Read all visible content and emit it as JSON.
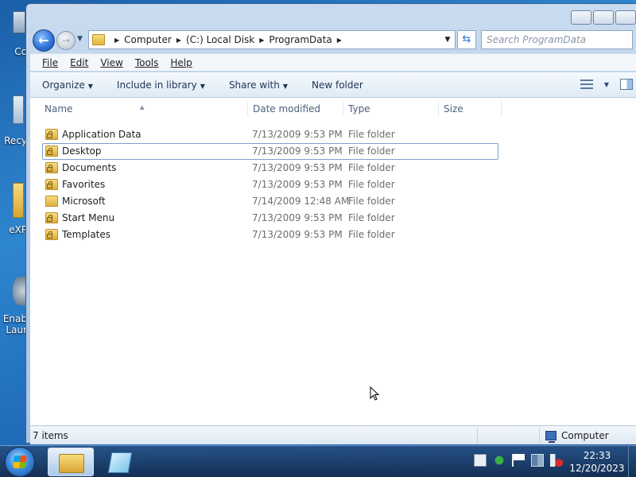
{
  "desktop": {
    "icons": [
      {
        "label": "Co",
        "icon": "computer-icon"
      },
      {
        "label": "Recy",
        "icon": "recycle-bin-icon"
      },
      {
        "label": "eXP",
        "icon": "folder-icon"
      },
      {
        "label": "Enab",
        "label2": "Laur",
        "icon": "launcher-icon"
      }
    ]
  },
  "window": {
    "address": {
      "crumbs": [
        "Computer",
        "(C:) Local Disk",
        "ProgramData"
      ]
    },
    "search": {
      "placeholder": "Search ProgramData"
    },
    "menu": [
      "File",
      "Edit",
      "View",
      "Tools",
      "Help"
    ],
    "toolbar": {
      "organize": "Organize",
      "include_library": "Include in library",
      "share_with": "Share with",
      "new_folder": "New folder"
    },
    "columns": {
      "name": "Name",
      "date": "Date modified",
      "type": "Type",
      "size": "Size"
    },
    "files": [
      {
        "name": "Application Data",
        "date": "7/13/2009 9:53 PM",
        "type": "File folder",
        "locked": true
      },
      {
        "name": "Desktop",
        "date": "7/13/2009 9:53 PM",
        "type": "File folder",
        "locked": true,
        "selected": true
      },
      {
        "name": "Documents",
        "date": "7/13/2009 9:53 PM",
        "type": "File folder",
        "locked": true
      },
      {
        "name": "Favorites",
        "date": "7/13/2009 9:53 PM",
        "type": "File folder",
        "locked": true
      },
      {
        "name": "Microsoft",
        "date": "7/14/2009 12:48 AM",
        "type": "File folder",
        "locked": false
      },
      {
        "name": "Start Menu",
        "date": "7/13/2009 9:53 PM",
        "type": "File folder",
        "locked": true
      },
      {
        "name": "Templates",
        "date": "7/13/2009 9:53 PM",
        "type": "File folder",
        "locked": true
      }
    ],
    "status": {
      "items": "7 items",
      "location": "Computer"
    }
  },
  "taskbar": {
    "time": "22:33",
    "date": "12/20/2023",
    "apps": [
      "explorer-folder-icon",
      "notepad-icon"
    ]
  },
  "colors": {
    "accent": "#2a6fd6",
    "selection_border": "#7da2ce"
  }
}
